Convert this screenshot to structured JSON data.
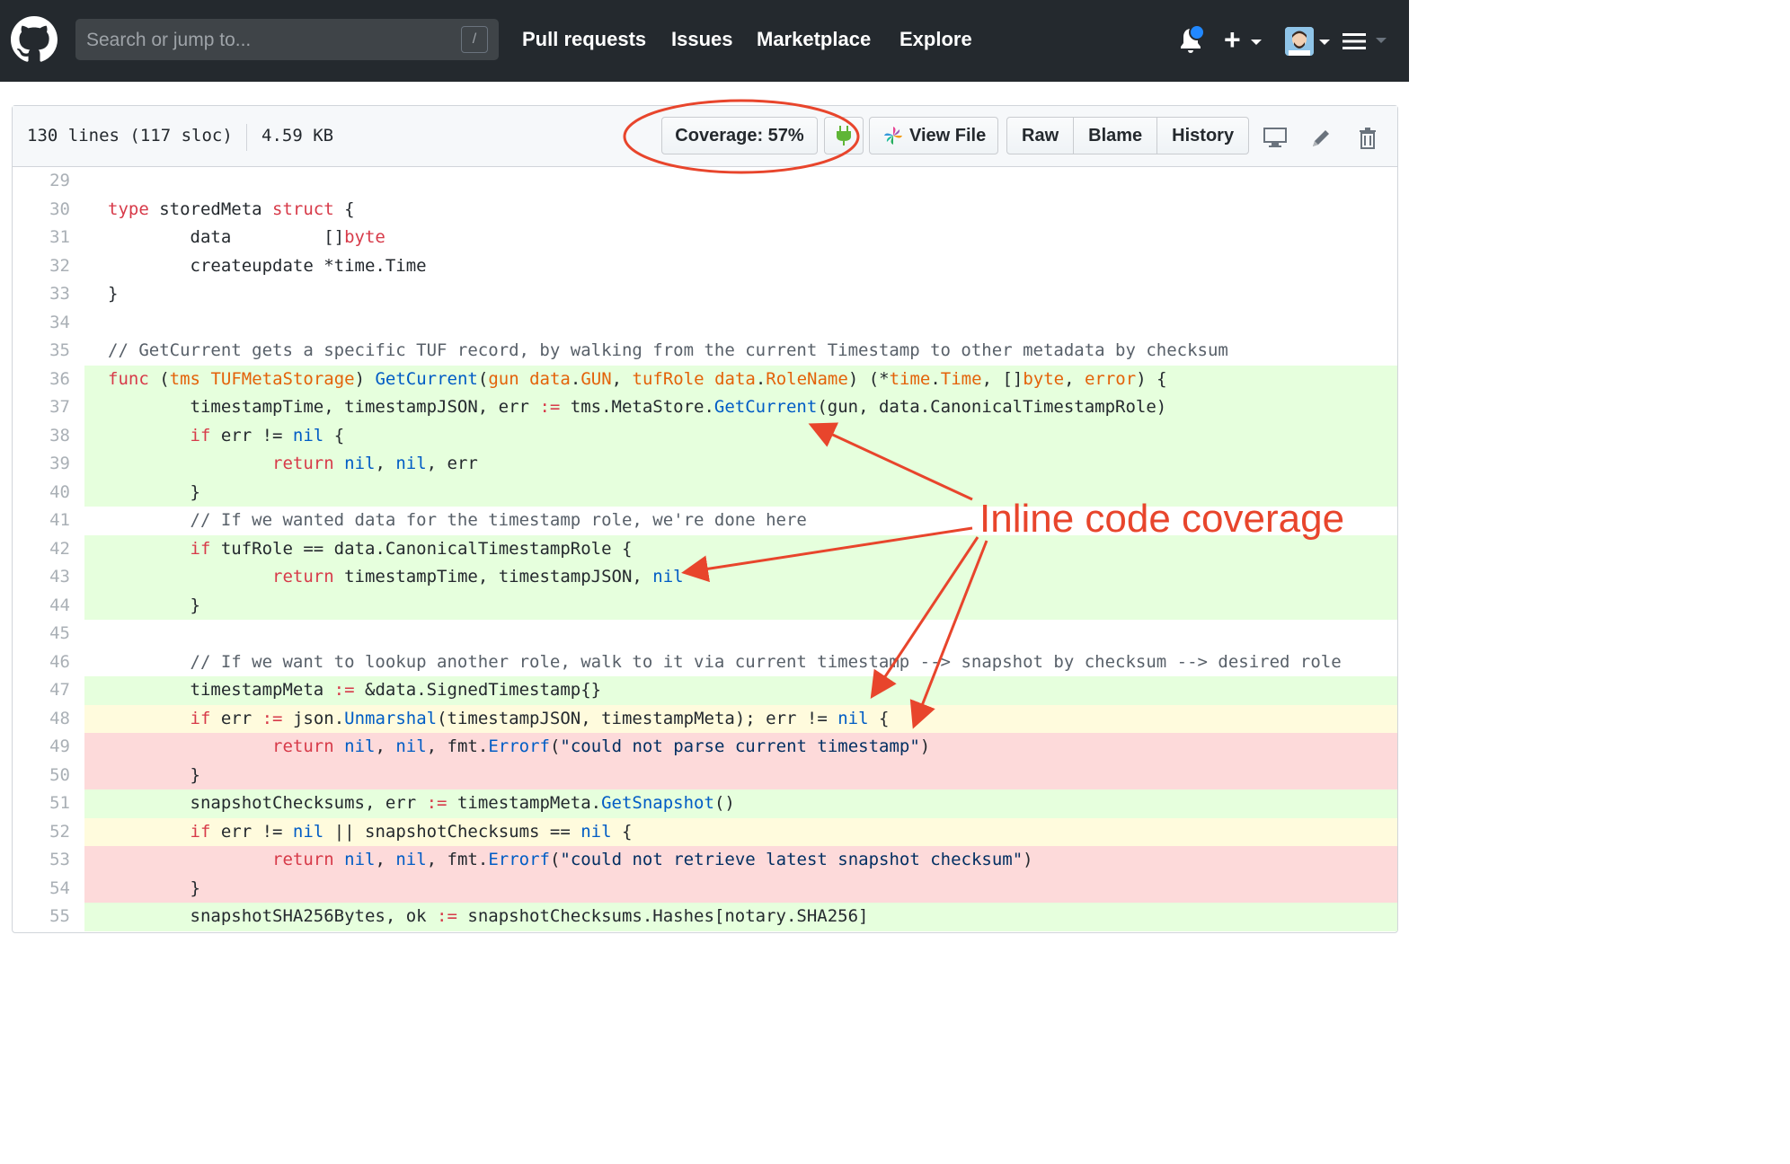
{
  "header": {
    "search_placeholder": "Search or jump to...",
    "search_shortcut": "/",
    "nav": [
      "Pull requests",
      "Issues",
      "Marketplace",
      "Explore"
    ],
    "notification_color": "#2188ff"
  },
  "file": {
    "lines_info": "130 lines (117 sloc)",
    "size": "4.59 KB",
    "coverage_label": "Coverage: 57%",
    "view_file_label": "View File",
    "raw_label": "Raw",
    "blame_label": "Blame",
    "history_label": "History"
  },
  "annotation": {
    "text": "Inline code coverage",
    "color": "#e8452c"
  },
  "coverage_colors": {
    "hit": "#e6ffdd",
    "miss": "#fddada",
    "partial": "#fffbdd"
  },
  "code": [
    {
      "n": "29",
      "cov": "none",
      "html": ""
    },
    {
      "n": "30",
      "cov": "none",
      "html": "<span class='k'>type</span> storedMeta <span class='k'>struct</span> {"
    },
    {
      "n": "31",
      "cov": "none",
      "html": "        data         []<span class='k'>byte</span>"
    },
    {
      "n": "32",
      "cov": "none",
      "html": "        createupdate *time.Time"
    },
    {
      "n": "33",
      "cov": "none",
      "html": "}"
    },
    {
      "n": "34",
      "cov": "none",
      "html": ""
    },
    {
      "n": "35",
      "cov": "none",
      "html": "<span class='c'>// GetCurrent gets a specific TUF record, by walking from the current Timestamp to other metadata by checksum</span>"
    },
    {
      "n": "36",
      "cov": "hit",
      "html": "<span class='k'>func</span> (<span class='o'>tms</span> <span class='o'>TUFMetaStorage</span>) <span class='f'>GetCurrent</span>(<span class='o'>gun</span> <span class='o'>data</span>.<span class='o'>GUN</span>, <span class='o'>tufRole</span> <span class='o'>data</span>.<span class='o'>RoleName</span>) (*<span class='o'>time</span>.<span class='o'>Time</span>, []<span class='o'>byte</span>, <span class='o'>error</span>) {"
    },
    {
      "n": "37",
      "cov": "hit",
      "html": "        timestampTime, timestampJSON, err <span class='k'>:=</span> tms.MetaStore.<span class='f'>GetCurrent</span>(gun, data.CanonicalTimestampRole)"
    },
    {
      "n": "38",
      "cov": "hit",
      "html": "        <span class='k'>if</span> err != <span class='f'>nil</span> {"
    },
    {
      "n": "39",
      "cov": "hit",
      "html": "                <span class='k'>return</span> <span class='f'>nil</span>, <span class='f'>nil</span>, err"
    },
    {
      "n": "40",
      "cov": "hit",
      "html": "        }"
    },
    {
      "n": "41",
      "cov": "none",
      "html": "        <span class='c'>// If we wanted data for the timestamp role, we're done here</span>"
    },
    {
      "n": "42",
      "cov": "hit",
      "html": "        <span class='k'>if</span> tufRole == data.CanonicalTimestampRole {"
    },
    {
      "n": "43",
      "cov": "hit",
      "html": "                <span class='k'>return</span> timestampTime, timestampJSON, <span class='f'>nil</span>"
    },
    {
      "n": "44",
      "cov": "hit",
      "html": "        }"
    },
    {
      "n": "45",
      "cov": "none",
      "html": ""
    },
    {
      "n": "46",
      "cov": "none",
      "html": "        <span class='c'>// If we want to lookup another role, walk to it via current timestamp --> snapshot by checksum --> desired role</span>"
    },
    {
      "n": "47",
      "cov": "hit",
      "html": "        timestampMeta <span class='k'>:=</span> &amp;data.SignedTimestamp{}"
    },
    {
      "n": "48",
      "cov": "partial",
      "html": "        <span class='k'>if</span> err <span class='k'>:=</span> json.<span class='f'>Unmarshal</span>(timestampJSON, timestampMeta); err != <span class='f'>nil</span> {"
    },
    {
      "n": "49",
      "cov": "miss",
      "html": "                <span class='k'>return</span> <span class='f'>nil</span>, <span class='f'>nil</span>, fmt.<span class='f'>Errorf</span>(<span class='s'>\"could not parse current timestamp\"</span>)"
    },
    {
      "n": "50",
      "cov": "miss",
      "html": "        }"
    },
    {
      "n": "51",
      "cov": "hit",
      "html": "        snapshotChecksums, err <span class='k'>:=</span> timestampMeta.<span class='f'>GetSnapshot</span>()"
    },
    {
      "n": "52",
      "cov": "partial",
      "html": "        <span class='k'>if</span> err != <span class='f'>nil</span> || snapshotChecksums == <span class='f'>nil</span> {"
    },
    {
      "n": "53",
      "cov": "miss",
      "html": "                <span class='k'>return</span> <span class='f'>nil</span>, <span class='f'>nil</span>, fmt.<span class='f'>Errorf</span>(<span class='s'>\"could not retrieve latest snapshot checksum\"</span>)"
    },
    {
      "n": "54",
      "cov": "miss",
      "html": "        }"
    },
    {
      "n": "55",
      "cov": "hit",
      "html": "        snapshotSHA256Bytes, ok <span class='k'>:=</span> snapshotChecksums.Hashes[notary.SHA256]"
    }
  ]
}
